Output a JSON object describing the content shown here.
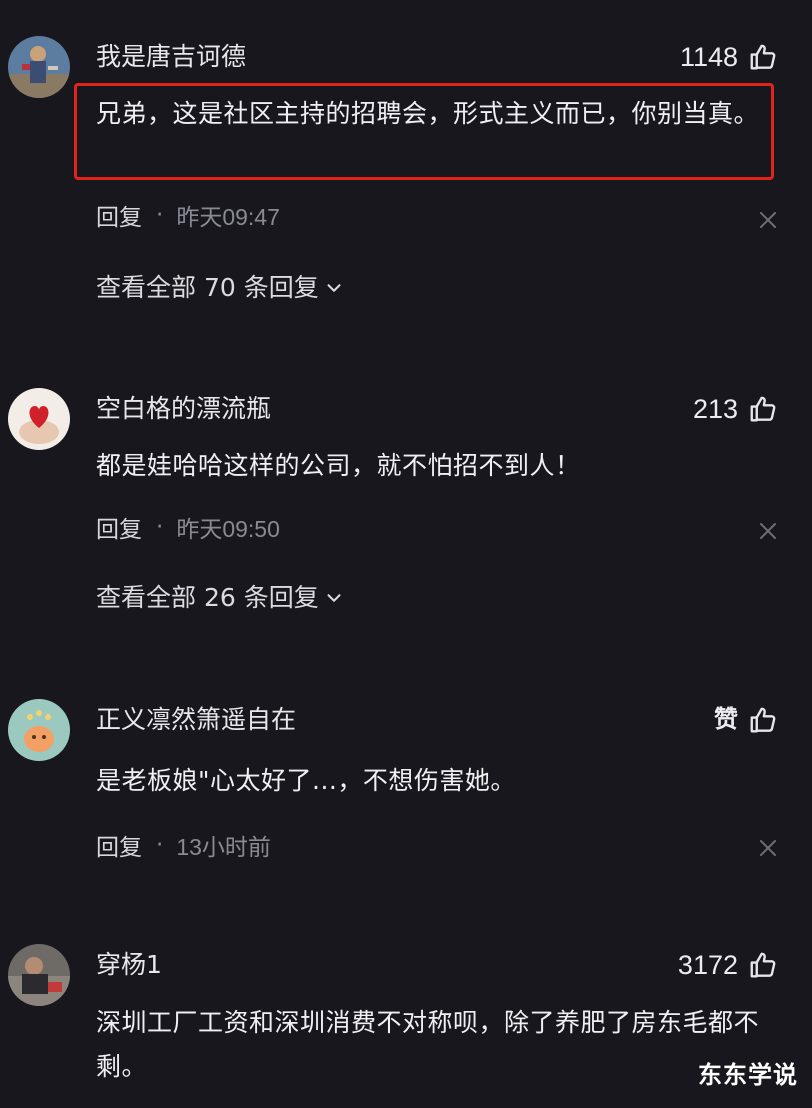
{
  "comments": [
    {
      "username": "我是唐吉诃德",
      "likes": "1148",
      "content": "兄弟，这是社区主持的招聘会，形式主义而已，你别当真。",
      "reply_label": "回复",
      "separator": "·",
      "time": "昨天09:47",
      "view_replies": "查看全部 70 条回复"
    },
    {
      "username": "空白格的漂流瓶",
      "likes": "213",
      "content": "都是娃哈哈这样的公司，就不怕招不到人！",
      "reply_label": "回复",
      "separator": "·",
      "time": "昨天09:50",
      "view_replies": "查看全部 26 条回复"
    },
    {
      "username": "正义凛然箫遥自在",
      "likes": "赞",
      "content": "是老板娘\"心太好了...，不想伤害她。",
      "reply_label": "回复",
      "separator": "·",
      "time": "13小时前"
    },
    {
      "username": "穿杨1",
      "likes": "3172",
      "content": "深圳工厂工资和深圳消费不对称呗，除了养肥了房东毛都不剩。"
    }
  ],
  "watermark": "东东学说",
  "colors": {
    "background": "#17171d",
    "highlight_border": "#e2231a",
    "muted_text": "#8a8a92"
  },
  "icons": [
    "thumbs-up-icon",
    "close-icon",
    "chevron-down-icon"
  ]
}
